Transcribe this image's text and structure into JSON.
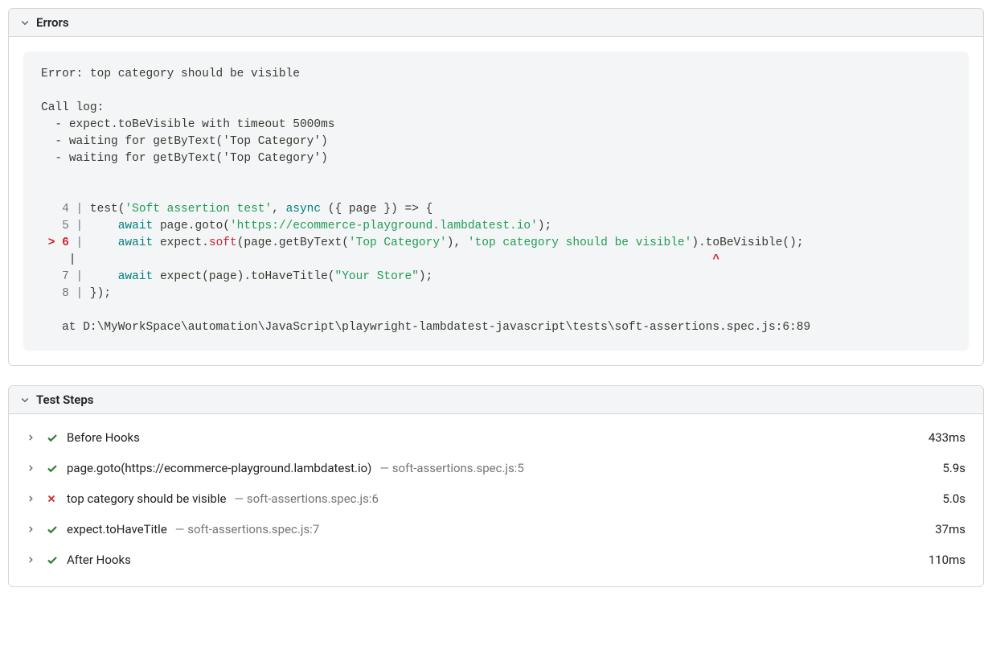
{
  "errors": {
    "title": "Errors",
    "message": "Error: top category should be visible",
    "call_log_label": "Call log:",
    "call_log": [
      "expect.toBeVisible with timeout 5000ms",
      "waiting for getByText('Top Category')",
      "waiting for getByText('Top Category')"
    ],
    "code": {
      "line4": {
        "num": "4",
        "pre": "test(",
        "testName": "'Soft assertion test'",
        "sep": ", ",
        "async": "async",
        "rest": " ({ page }) => {"
      },
      "line5": {
        "num": "5",
        "pre": "    ",
        "await": "await",
        "mid": " page.goto(",
        "url": "'https://ecommerce-playground.lambdatest.io'",
        "post": ");"
      },
      "line6": {
        "marker": ">",
        "num": "6",
        "pre": "    ",
        "await": "await",
        "mid1": " expect.",
        "soft": "soft",
        "mid2": "(page.getByText(",
        "txt1": "'Top Category'",
        "mid3": "), ",
        "txt2": "'top category should be visible'",
        "mid4": ").toBeVisible();"
      },
      "caret": {
        "pad": "    |                                                                                           ",
        "caret": "^"
      },
      "line7": {
        "num": "7",
        "pre": "    ",
        "await": "await",
        "mid": " expect(page).toHaveTitle(",
        "title": "\"Your Store\"",
        "post": ");"
      },
      "line8": {
        "num": "8",
        "text": "});"
      }
    },
    "stack": "   at D:\\MyWorkSpace\\automation\\JavaScript\\playwright-lambdatest-javascript\\tests\\soft-assertions.spec.js:6:89"
  },
  "steps": {
    "title": "Test Steps",
    "rows": [
      {
        "status": "pass",
        "label": "Before Hooks",
        "meta": "",
        "duration": "433ms"
      },
      {
        "status": "pass",
        "label": "page.goto(https://ecommerce-playground.lambdatest.io)",
        "meta": " — soft-assertions.spec.js:5",
        "duration": "5.9s"
      },
      {
        "status": "fail",
        "label": "top category should be visible",
        "meta": " — soft-assertions.spec.js:6",
        "duration": "5.0s"
      },
      {
        "status": "pass",
        "label": "expect.toHaveTitle",
        "meta": " — soft-assertions.spec.js:7",
        "duration": "37ms"
      },
      {
        "status": "pass",
        "label": "After Hooks",
        "meta": "",
        "duration": "110ms"
      }
    ]
  }
}
